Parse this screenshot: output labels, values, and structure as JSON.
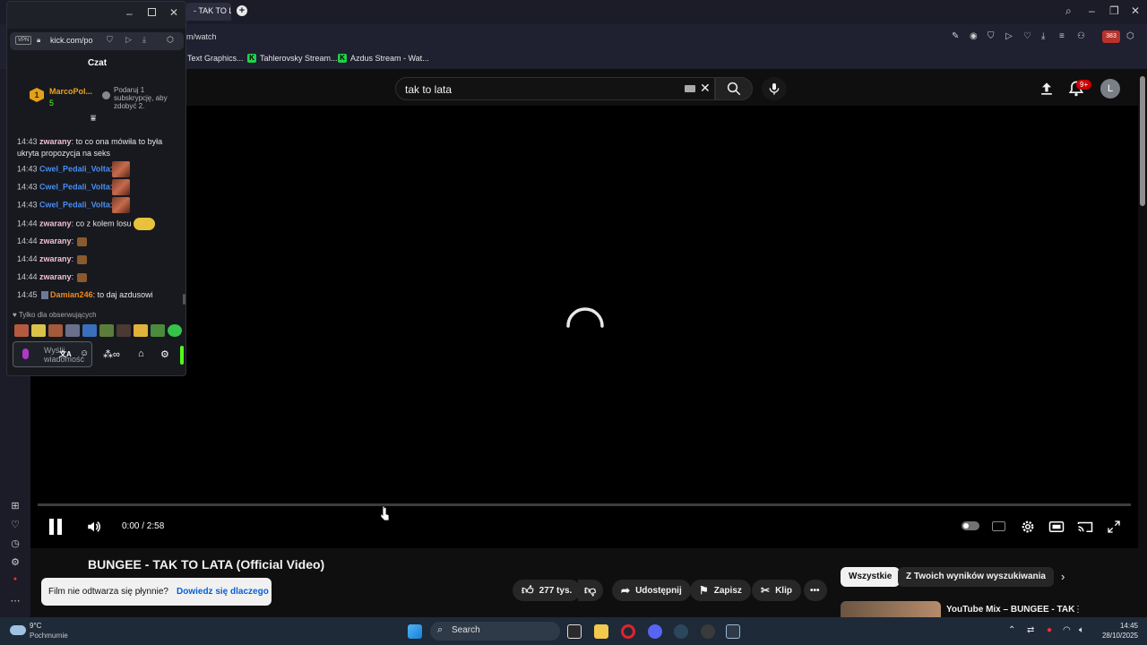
{
  "browser": {
    "tab_title": "- TAK TO LA",
    "url_partial": "m/watch",
    "bookmarks": [
      "Text Graphics...",
      "Tahlerovsky Stream...",
      "Azdus Stream - Wat..."
    ],
    "badge_count": "383"
  },
  "kick": {
    "url": "kick.com/po",
    "vpn_label": "VPN",
    "chat_title": "Czat",
    "pinned_user": "MarcoPol...",
    "pinned_rank": "1",
    "pinned_sub_count": "5",
    "gift_text": "Podaruj 1 subskrypcję, aby zdobyć 2.",
    "messages": [
      {
        "time": "14:43",
        "user": "zwarany",
        "text": ": to co ona mówiła to była ukryta propozycja na seks"
      },
      {
        "time": "14:43",
        "user": "Cwel_Pedali_Volta",
        "text": ":"
      },
      {
        "time": "14:43",
        "user": "Cwel_Pedali_Volta",
        "text": ":"
      },
      {
        "time": "14:43",
        "user": "Cwel_Pedali_Volta",
        "text": ":"
      },
      {
        "time": "14:44",
        "user": "zwarany",
        "text": ": co z kolem losu"
      },
      {
        "time": "14:44",
        "user": "zwarany",
        "text": ":"
      },
      {
        "time": "14:44",
        "user": "zwarany",
        "text": ":"
      },
      {
        "time": "14:44",
        "user": "zwarany",
        "text": ":"
      },
      {
        "time": "14:45",
        "user": "Damian246",
        "text": ": to daj azdusowi"
      }
    ],
    "followers_only": "Tylko dla obserwujących",
    "input_placeholder": "Wyślij wiadomość"
  },
  "youtube": {
    "search_query": "tak to lata",
    "notification_badge": "9+",
    "avatar_letter": "L",
    "time_display": "0:00 / 2:58",
    "video_title": "BUNGEE - TAK TO LATA (Official Video)",
    "likes": "277 tys.",
    "share_label": "Udostępnij",
    "save_label": "Zapisz",
    "clip_label": "Klip",
    "toast_text": "Film nie odtwarza się płynnie?",
    "toast_link": "Dowiedz się dlaczego",
    "chips": [
      "Wszystkie",
      "Z Twoich wyników wyszukiwania"
    ],
    "rec_title": "YouTube Mix – BUNGEE - TAK"
  },
  "taskbar": {
    "weather_temp": "9°C",
    "weather_desc": "Pochmurnie",
    "search_label": "Search",
    "time": "14:45",
    "date": "28/10/2025"
  },
  "colors": {
    "kick_green": "#53fc18",
    "yt_bg": "#0f0f0f",
    "notification_red": "#cc0000",
    "link_blue": "#065fd4"
  }
}
